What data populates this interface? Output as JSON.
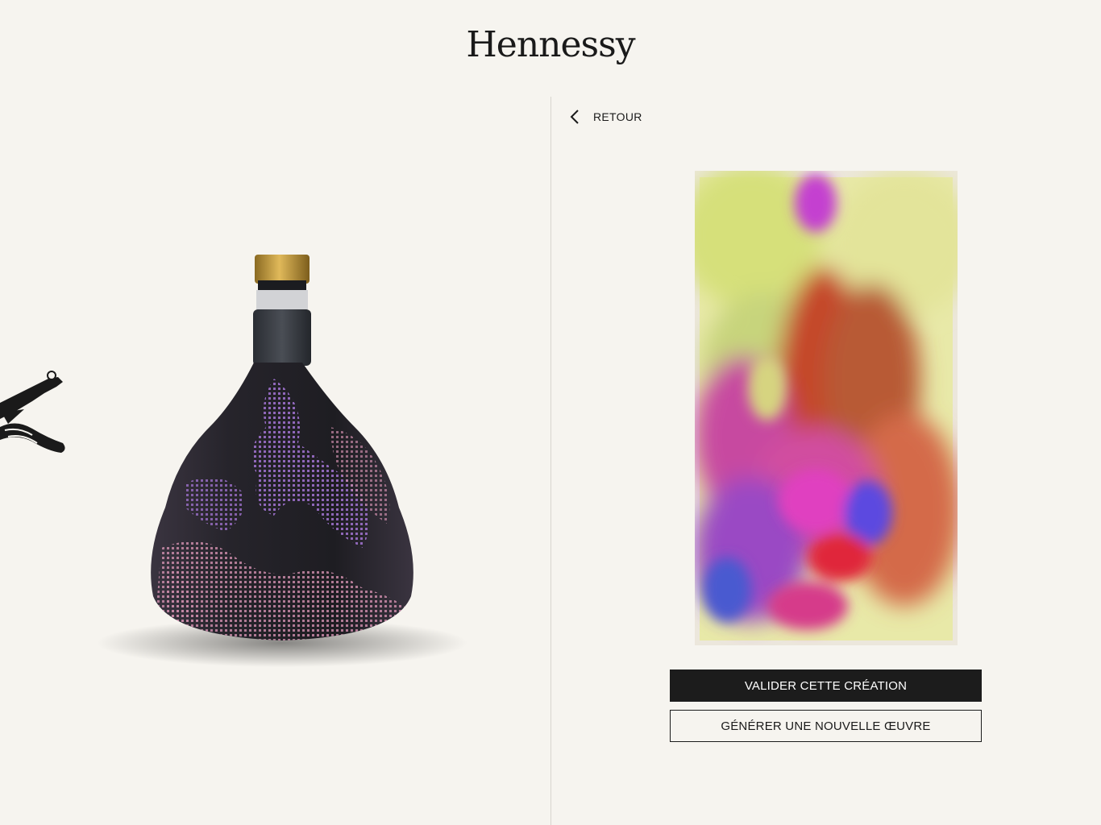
{
  "header": {
    "brand": "Hennessy"
  },
  "nav": {
    "back_label": "RETOUR",
    "back_icon": "chevron-left-icon"
  },
  "product": {
    "bottle_image": "bottle-image",
    "artwork_image": "generated-artwork-image"
  },
  "actions": {
    "validate_label": "VALIDER CETTE CRÉATION",
    "generate_label": "GÉNÉRER UNE NOUVELLE ŒUVRE"
  },
  "colors": {
    "background": "#f6f4ef",
    "primary_button": "#1c1c1c",
    "text": "#1a1a1a"
  }
}
